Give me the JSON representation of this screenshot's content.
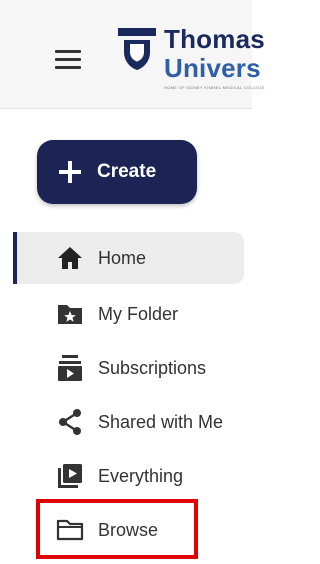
{
  "header": {
    "menu_icon": "hamburger-icon",
    "logo": {
      "line1": "Thomas",
      "line2": "Univers",
      "tagline": "HOME OF SIDNEY KIMMEL MEDICAL COLLEGE"
    }
  },
  "create_button": {
    "label": "Create",
    "icon": "plus-icon"
  },
  "nav": {
    "items": [
      {
        "label": "Home",
        "icon": "home-icon",
        "active": true
      },
      {
        "label": "My Folder",
        "icon": "folder-star-icon"
      },
      {
        "label": "Subscriptions",
        "icon": "subscriptions-icon"
      },
      {
        "label": "Shared with Me",
        "icon": "share-icon"
      },
      {
        "label": "Everything",
        "icon": "video-library-icon"
      },
      {
        "label": "Browse",
        "icon": "folder-icon"
      }
    ]
  },
  "colors": {
    "brand_navy": "#1b2454",
    "brand_blue": "#2f5fa7",
    "highlight_red": "#e00000",
    "active_bg": "#ececec"
  }
}
